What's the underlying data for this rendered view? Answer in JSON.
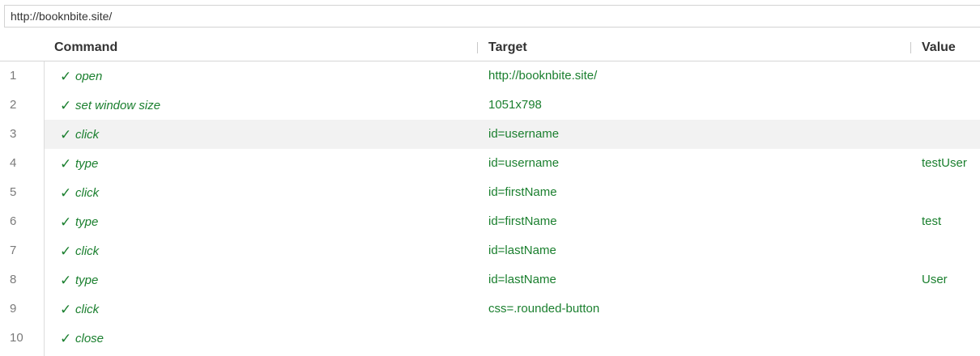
{
  "url": "http://booknbite.site/",
  "header": {
    "command": "Command",
    "target": "Target",
    "value": "Value"
  },
  "status_color": "#1a7f2e",
  "selected_row": 3,
  "rows": [
    {
      "num": "1",
      "status": "✓",
      "command": "open",
      "target": "http://booknbite.site/",
      "value": ""
    },
    {
      "num": "2",
      "status": "✓",
      "command": "set window size",
      "target": "1051x798",
      "value": ""
    },
    {
      "num": "3",
      "status": "✓",
      "command": "click",
      "target": "id=username",
      "value": ""
    },
    {
      "num": "4",
      "status": "✓",
      "command": "type",
      "target": "id=username",
      "value": "testUser"
    },
    {
      "num": "5",
      "status": "✓",
      "command": "click",
      "target": "id=firstName",
      "value": ""
    },
    {
      "num": "6",
      "status": "✓",
      "command": "type",
      "target": "id=firstName",
      "value": "test"
    },
    {
      "num": "7",
      "status": "✓",
      "command": "click",
      "target": "id=lastName",
      "value": ""
    },
    {
      "num": "8",
      "status": "✓",
      "command": "type",
      "target": "id=lastName",
      "value": "User"
    },
    {
      "num": "9",
      "status": "✓",
      "command": "click",
      "target": "css=.rounded-button",
      "value": ""
    },
    {
      "num": "10",
      "status": "✓",
      "command": "close",
      "target": "",
      "value": ""
    }
  ]
}
